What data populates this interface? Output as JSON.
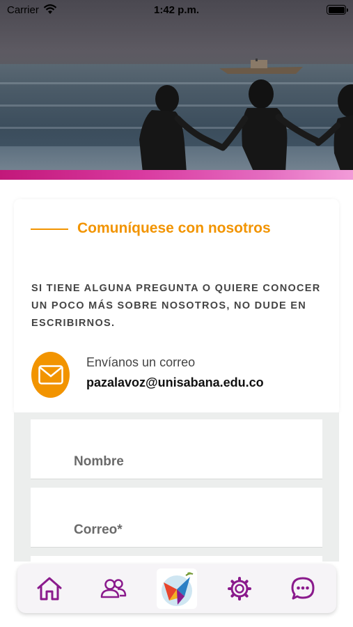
{
  "status_bar": {
    "carrier": "Carrier",
    "time": "1:42 p.m."
  },
  "contact_card": {
    "title": "Comuníquese con nosotros",
    "description": "SI TIENE ALGUNA PREGUNTA O QUIERE CONOCER UN POCO MÁS SOBRE NOSOTROS, NO DUDE EN ESCRIBIRNOS.",
    "email_label": "Envíanos un correo",
    "email_address": "pazalavoz@unisabana.edu.co"
  },
  "form": {
    "name_placeholder": "Nombre",
    "email_placeholder": "Correo*"
  },
  "bottom_nav": {
    "items": [
      "home-icon",
      "community-icon",
      "app-logo",
      "settings-gear-icon",
      "chat-icon"
    ]
  },
  "colors": {
    "accent_orange": "#f29400",
    "nav_purple": "#8a1a8c",
    "pink_bar": "#d93aa0"
  }
}
